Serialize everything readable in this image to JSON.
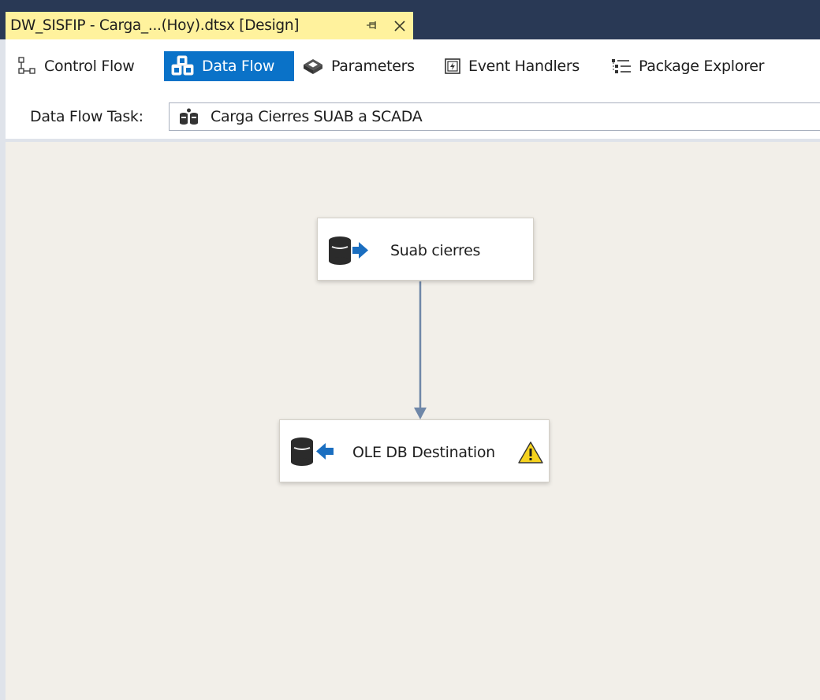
{
  "document_tab": {
    "title": "DW_SISFIP - Carga_...(Hoy).dtsx [Design]",
    "pin_icon": "pin-icon",
    "close_icon": "close-icon"
  },
  "designer_tabs": [
    {
      "label": "Control Flow",
      "icon": "control-flow-icon",
      "active": false
    },
    {
      "label": "Data Flow",
      "icon": "data-flow-icon",
      "active": true
    },
    {
      "label": "Parameters",
      "icon": "parameters-icon",
      "active": false
    },
    {
      "label": "Event Handlers",
      "icon": "event-handlers-icon",
      "active": false
    },
    {
      "label": "Package Explorer",
      "icon": "package-explorer-icon",
      "active": false
    }
  ],
  "task_selector": {
    "label": "Data Flow Task:",
    "value": "Carga Cierres SUAB a SCADA",
    "icon": "data-flow-task-icon"
  },
  "canvas": {
    "components": [
      {
        "label": "Suab cierres",
        "icon": "database-source-icon"
      },
      {
        "label": "OLE DB Destination",
        "icon": "database-destination-icon",
        "status_icon": "warning-icon"
      }
    ]
  },
  "colors": {
    "title_strip": "#293955",
    "active_doc_tab": "#fff29d",
    "active_designer_tab": "#0a72c8",
    "canvas": "#f2efe9",
    "connector": "#6f87a8"
  }
}
